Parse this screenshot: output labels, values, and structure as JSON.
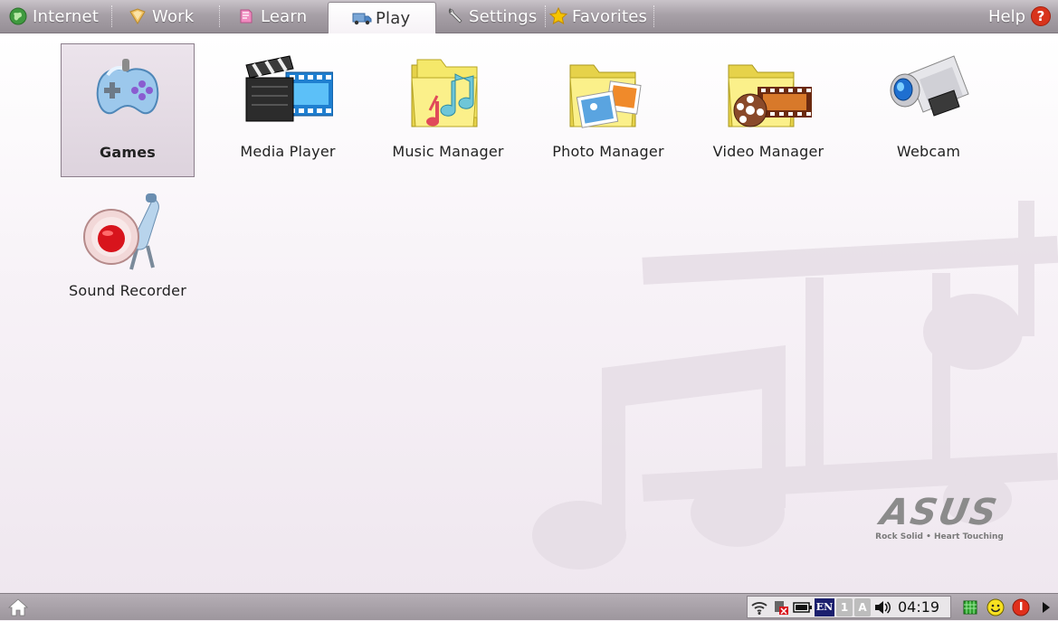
{
  "tabs": [
    {
      "label": "Internet",
      "icon": "globe-icon"
    },
    {
      "label": "Work",
      "icon": "folder-icon"
    },
    {
      "label": "Learn",
      "icon": "book-icon"
    },
    {
      "label": "Play",
      "icon": "truck-icon",
      "active": true
    },
    {
      "label": "Settings",
      "icon": "wrench-icon"
    },
    {
      "label": "Favorites",
      "icon": "star-icon"
    }
  ],
  "help": {
    "label": "Help",
    "icon": "question-icon",
    "glyph": "?"
  },
  "apps": [
    {
      "label": "Games",
      "icon": "gamepad-icon",
      "selected": true
    },
    {
      "label": "Media Player",
      "icon": "clapperboard-icon"
    },
    {
      "label": "Music Manager",
      "icon": "music-folder-icon"
    },
    {
      "label": "Photo Manager",
      "icon": "photo-folder-icon"
    },
    {
      "label": "Video Manager",
      "icon": "video-folder-icon"
    },
    {
      "label": "Webcam",
      "icon": "webcam-icon"
    },
    {
      "label": "Sound Recorder",
      "icon": "microphone-icon"
    }
  ],
  "brand": {
    "logo": "ASUS",
    "tagline": "Rock Solid • Heart Touching"
  },
  "taskbar": {
    "home_icon": "home-icon",
    "tray": {
      "language": "EN",
      "keyboard_indicator_1": "1",
      "keyboard_indicator_2": "A",
      "clock": "04:19"
    }
  },
  "colors": {
    "help_red": "#d8341c",
    "star": "#f5c400",
    "record_red": "#d8141c"
  }
}
